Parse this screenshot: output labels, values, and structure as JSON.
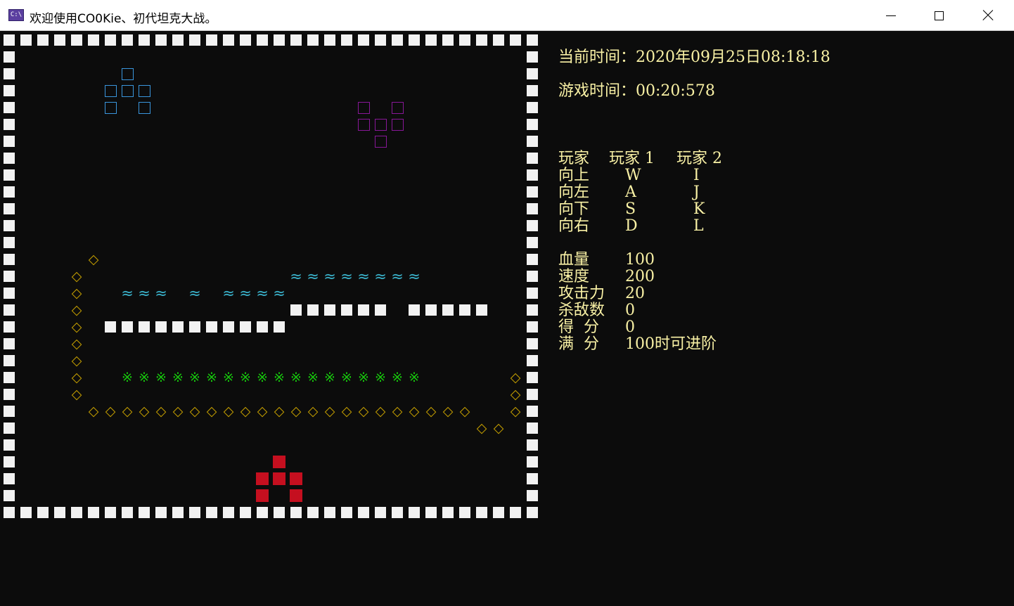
{
  "window": {
    "title": "欢迎使用CO0Kie、初代坦克大战。",
    "icon": "console-app-icon",
    "icon_text": "C:\\"
  },
  "header": {
    "current_time_label": "当前时间：",
    "current_time_value": "2020年09月25日08:18:18",
    "game_time_label": "游戏时间：",
    "game_time_value": "00:20:578"
  },
  "controls": {
    "rows": [
      {
        "action": "玩家",
        "p1": "玩家 1",
        "p2": "玩家 2"
      },
      {
        "action": "向上",
        "p1": "W",
        "p2": "I"
      },
      {
        "action": "向左",
        "p1": "A",
        "p2": "J"
      },
      {
        "action": "向下",
        "p1": "S",
        "p2": "K"
      },
      {
        "action": "向右",
        "p1": "D",
        "p2": "L"
      }
    ]
  },
  "stats": [
    {
      "label": "血量",
      "value": "100"
    },
    {
      "label": "速度",
      "value": "200"
    },
    {
      "label": "攻击力",
      "value": "20"
    },
    {
      "label": "杀敌数",
      "value": "0"
    },
    {
      "label": "得  分",
      "value": "0"
    },
    {
      "label": "满  分",
      "value": "100时可进阶"
    }
  ],
  "glyphs": {
    "diamond": "◇",
    "water": "≈",
    "grass": "※"
  },
  "colors": {
    "background": "#0c0c0c",
    "wall": "#f2f2f2",
    "info_text": "#f9f1a5",
    "enemy_tank_blue": "#3a96dd",
    "enemy_tank_purple": "#881798",
    "player_tank": "#c50f1f",
    "diamond": "#c19c00",
    "water": "#3ab3cc",
    "grass": "#16c60c"
  }
}
